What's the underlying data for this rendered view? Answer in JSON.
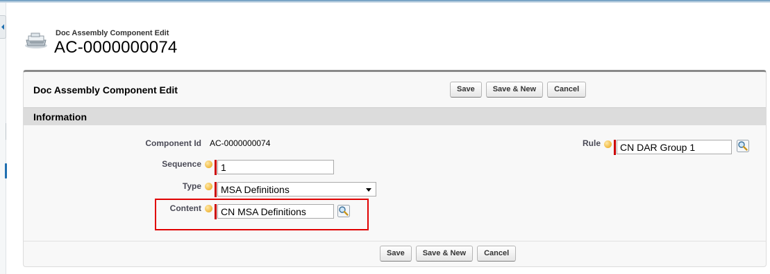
{
  "header": {
    "subtitle": "Doc Assembly Component Edit",
    "title": "AC-0000000074"
  },
  "block": {
    "title": "Doc Assembly Component Edit",
    "buttons": {
      "save": "Save",
      "save_new": "Save & New",
      "cancel": "Cancel"
    }
  },
  "section": {
    "title": "Information"
  },
  "fields": {
    "component_id": {
      "label": "Component Id",
      "value": "AC-0000000074"
    },
    "sequence": {
      "label": "Sequence",
      "value": "1"
    },
    "type": {
      "label": "Type",
      "value": "MSA Definitions"
    },
    "content": {
      "label": "Content",
      "value": "CN MSA Definitions"
    },
    "rule": {
      "label": "Rule",
      "value": "CN DAR Group 1"
    }
  },
  "footer": {
    "buttons": {
      "save": "Save",
      "save_new": "Save & New",
      "cancel": "Cancel"
    }
  },
  "colors": {
    "highlight": "#e00000",
    "required": "#cc0000",
    "accent": "#1f6fb0"
  },
  "icons": [
    "collapse-sidebar-icon",
    "component-record-icon",
    "help-icon",
    "lookup-magnifier-icon",
    "dropdown-arrow-icon"
  ]
}
